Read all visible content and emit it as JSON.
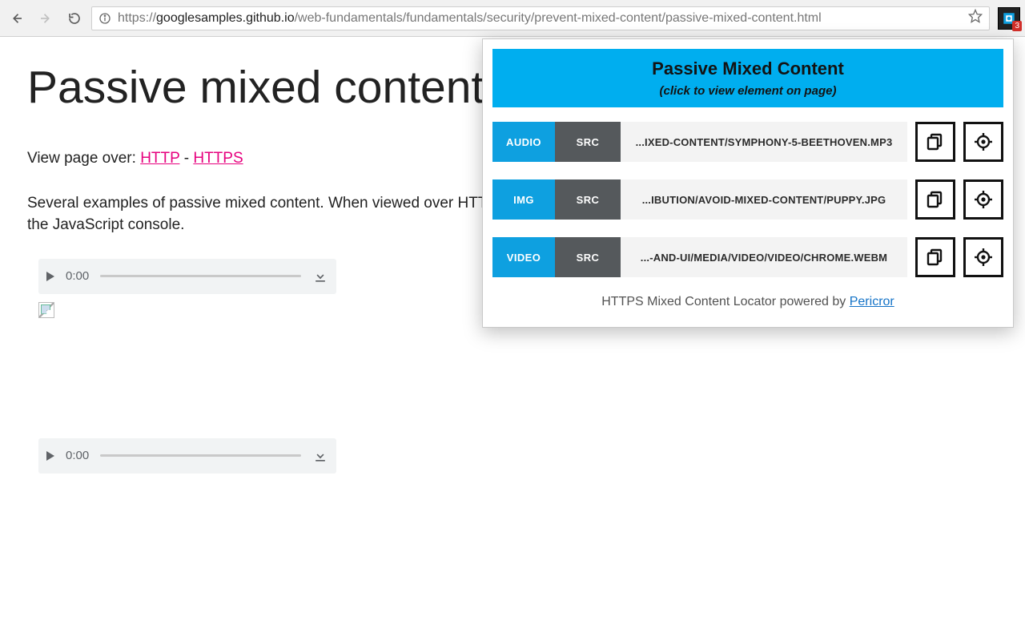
{
  "chrome": {
    "url_host": "googlesamples.github.io",
    "url_path": "/web-fundamentals/fundamentals/security/prevent-mixed-content/passive-mixed-content.html",
    "url_scheme": "https://",
    "ext_badge": "3"
  },
  "page": {
    "title": "Passive mixed content!",
    "view_label": "View page over: ",
    "link_http": "HTTP",
    "link_sep": " - ",
    "link_https": "HTTPS",
    "paragraph": "Several examples of passive mixed content. When viewed over HTTPS most browsers do not block this content but instead display warnings in the JavaScript console.",
    "time0": "0:00"
  },
  "popup": {
    "title": "Passive Mixed Content",
    "subtitle": "(click to view element on page)",
    "rows": [
      {
        "type": "AUDIO",
        "attr": "SRC",
        "path": "...IXED-CONTENT/SYMPHONY-5-BEETHOVEN.MP3"
      },
      {
        "type": "IMG",
        "attr": "SRC",
        "path": "...IBUTION/AVOID-MIXED-CONTENT/PUPPY.JPG"
      },
      {
        "type": "VIDEO",
        "attr": "SRC",
        "path": "...-AND-UI/MEDIA/VIDEO/VIDEO/CHROME.WEBM"
      }
    ],
    "footer_text": "HTTPS Mixed Content Locator powered by ",
    "footer_link": "Pericror"
  }
}
